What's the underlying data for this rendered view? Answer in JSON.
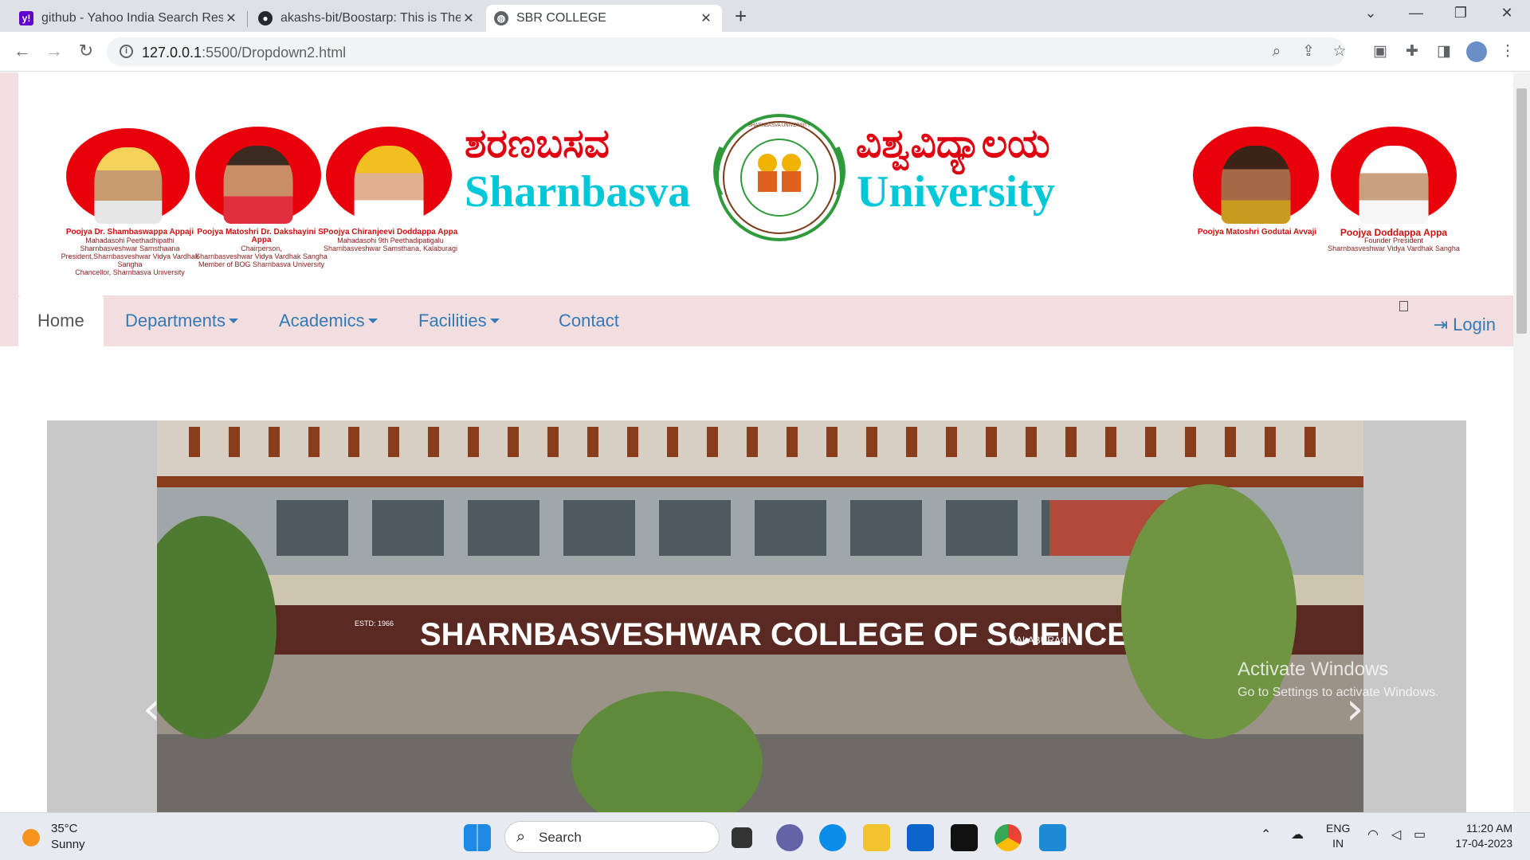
{
  "browser": {
    "tabs": [
      {
        "title": "github - Yahoo India Search Resu",
        "icon": "yahoo-icon",
        "active": false
      },
      {
        "title": "akashs-bit/Boostarp: This is The C",
        "icon": "github-icon",
        "active": false
      },
      {
        "title": "SBR COLLEGE",
        "icon": "globe-icon",
        "active": true
      }
    ],
    "new_tab": "+",
    "url": "127.0.0.1:5500/Dropdown2.html",
    "url_host": "127.0.0.1",
    "url_rest": ":5500/Dropdown2.html"
  },
  "header": {
    "kannada_left": "ಶರಣಬಸವ",
    "english_left": "Sharnbasva",
    "kannada_right": "ವಿಶ್ವವಿದ್ಯಾಲಯ",
    "english_right": "University",
    "emblem_text": "SHARNBASVA UNIVERSITY",
    "people": [
      {
        "name": "Poojya Dr. Shambaswappa Appaji",
        "lines": [
          "Mahadasohi Peethadhipathi",
          "Sharnbasveshwar Samsthaana",
          "President,Sharnbasveshwar Vidya Vardhak Sangha",
          "Chancellor, Sharnbasva University"
        ]
      },
      {
        "name": "Poojya Matoshri Dr. Dakshayini S. Appa",
        "lines": [
          "Chairperson,",
          "Sharnbasveshwar Vidya Vardhak Sangha",
          "Member of BOG  Sharnbasva University"
        ]
      },
      {
        "name": "Poojya Chiranjeevi Doddappa Appa",
        "lines": [
          "Mahadasohi 9th Peethadipatigalu",
          "Sharnbasveshwar Samsthana, Kalaburagi"
        ]
      },
      {
        "name": "Poojya Matoshri Godutai Avvaji",
        "lines": []
      },
      {
        "name": "Poojya Doddappa Appa",
        "lines": [
          "Founder President",
          "Sharnbasveshwar Vidya Vardhak Sangha"
        ]
      }
    ]
  },
  "nav": {
    "items": [
      {
        "label": "Home",
        "active": true,
        "dropdown": false
      },
      {
        "label": "Departments",
        "active": false,
        "dropdown": true
      },
      {
        "label": "Academics",
        "active": false,
        "dropdown": true
      },
      {
        "label": "Facilities",
        "active": false,
        "dropdown": true
      },
      {
        "label": "Contact",
        "active": false,
        "dropdown": false
      }
    ],
    "login": "Login"
  },
  "carousel": {
    "building_sign": "SHARNBASVESHWAR COLLEGE OF SCIENCE",
    "sign_sub": "KALABURAGI",
    "sign_estd": "ESTD: 1966",
    "prev": "‹",
    "next": "›"
  },
  "watermark": {
    "line1": "Activate Windows",
    "line2": "Go to Settings to activate Windows."
  },
  "taskbar": {
    "temp": "35°C",
    "condition": "Sunny",
    "search": "Search",
    "lang": "ENG",
    "region": "IN",
    "time": "11:20 AM",
    "date": "17-04-2023"
  },
  "colors": {
    "accent_red": "#e00010",
    "accent_cyan": "#00c8d8",
    "nav_bg": "#f2dede",
    "link": "#337ab7"
  }
}
